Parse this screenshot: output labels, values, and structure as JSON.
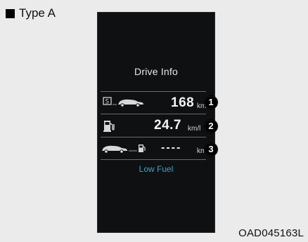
{
  "caption": {
    "label": "Type A"
  },
  "display": {
    "title": "Drive Info",
    "rows": [
      {
        "icon": "s-mode-car-icon",
        "value": "168",
        "unit": "km",
        "marker": "1"
      },
      {
        "icon": "fuel-pump-icon",
        "value": "24.7",
        "unit": "km/l",
        "marker": "2"
      },
      {
        "icon": "car-fuel-icon",
        "value": "----",
        "unit": "km",
        "marker": "3"
      }
    ],
    "status": "Low Fuel"
  },
  "figure_code": "OAD045163L",
  "colors": {
    "screen_bg": "#0f1012",
    "accent": "#35a7c6",
    "text": "#f4f4f4"
  }
}
